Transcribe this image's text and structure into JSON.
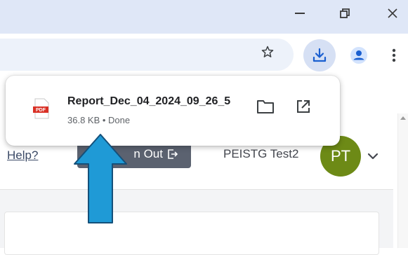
{
  "window": {
    "minimize_icon": "minimize-icon",
    "restore_icon": "restore-icon",
    "close_icon": "close-icon"
  },
  "toolbar": {
    "bookmark_icon": "star-icon",
    "download_icon": "download-icon",
    "profile_icon": "profile-icon",
    "menu_icon": "kebab-menu-icon"
  },
  "download_popup": {
    "file_name": "Report_Dec_04_2024_09_26_5",
    "status": "36.8 KB • Done",
    "file_type_label": "PDF",
    "folder_icon": "folder-icon",
    "open_icon": "open-external-icon"
  },
  "page_header": {
    "help_link": "Help?",
    "sign_out_label": "n Out",
    "user_name": "PEISTG Test2",
    "avatar_initials": "PT"
  },
  "colors": {
    "titlebar": "#dfe7f7",
    "download_button_bg": "#d6e0f4",
    "accent_blue": "#1a73e8",
    "avatar_bg": "#6d8a16",
    "sign_out_bg": "#5b6270",
    "annotation_arrow": "#1f9ad6"
  }
}
